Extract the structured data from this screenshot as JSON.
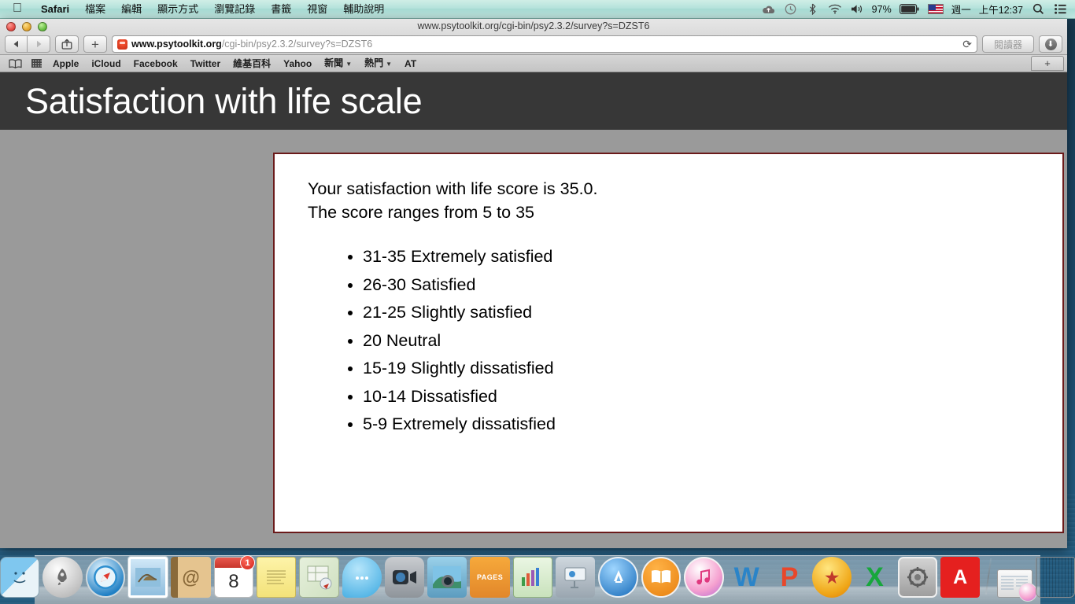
{
  "menubar": {
    "apple_logo": "apple-logo",
    "app_name": "Safari",
    "items": [
      "檔案",
      "編輯",
      "顯示方式",
      "瀏覽記錄",
      "書籤",
      "視窗",
      "輔助說明"
    ],
    "status": {
      "cloud_icon": "cloud-upload-icon",
      "timemachine_icon": "time-machine-icon",
      "bluetooth_icon": "bluetooth-icon",
      "wifi_icon": "wifi-icon",
      "volume_icon": "volume-icon",
      "battery_percent": "97%",
      "battery_icon": "battery-icon",
      "input_flag": "us-flag-icon",
      "day": "週一",
      "time": "上午12:37",
      "search_icon": "spotlight-search-icon",
      "notifications_icon": "notification-center-icon"
    }
  },
  "window": {
    "title": "www.psytoolkit.org/cgi-bin/psy2.3.2/survey?s=DZST6",
    "traffic_lights": [
      "close",
      "minimize",
      "zoom"
    ],
    "toolbar": {
      "back_label": "◀",
      "forward_label": "▶",
      "share_label": "⬆",
      "newtab_label": "+",
      "url_host": "www.psytoolkit.org",
      "url_path": "/cgi-bin/psy2.3.2/survey?s=DZST6",
      "reload_label": "⟳",
      "reader_label": "閱讀器",
      "download_label": "⬇"
    },
    "bookmarks_bar": {
      "sidebar_icon": "book-sidebar-icon",
      "topsites_icon": "top-sites-grid-icon",
      "items": [
        {
          "label": "Apple",
          "has_caret": false
        },
        {
          "label": "iCloud",
          "has_caret": false
        },
        {
          "label": "Facebook",
          "has_caret": false
        },
        {
          "label": "Twitter",
          "has_caret": false
        },
        {
          "label": "維基百科",
          "has_caret": false
        },
        {
          "label": "Yahoo",
          "has_caret": false
        },
        {
          "label": "新聞",
          "has_caret": true
        },
        {
          "label": "熱門",
          "has_caret": true
        },
        {
          "label": "AT",
          "has_caret": false
        }
      ],
      "new_tab_label": "+"
    }
  },
  "page": {
    "heading": "Satisfaction with life scale",
    "card": {
      "line1": "Your satisfaction with life score is 35.0.",
      "line2": "The score ranges from 5 to 35",
      "ranges": [
        "31-35 Extremely satisfied",
        "26-30 Satisfied",
        "21-25 Slightly satisfied",
        "20 Neutral",
        "15-19 Slightly dissatisfied",
        "10-14 Dissatisfied",
        "5-9 Extremely dissatisfied"
      ],
      "border_color": "#6b1a1a",
      "background_color": "#ffffff"
    },
    "header_background": "#373737",
    "body_background": "#9a9a9a"
  },
  "dock": {
    "items": [
      {
        "name": "finder",
        "glyph": "",
        "class": "ic-finder"
      },
      {
        "name": "launchpad",
        "glyph": "🚀",
        "class": "ic-launchpad"
      },
      {
        "name": "safari",
        "glyph": "✛",
        "class": "ic-safari"
      },
      {
        "name": "mail",
        "glyph": "",
        "class": "ic-mail"
      },
      {
        "name": "contacts",
        "glyph": "@",
        "class": "ic-contacts"
      },
      {
        "name": "calendar",
        "glyph": "8",
        "class": "ic-calendar",
        "badge": "1"
      },
      {
        "name": "notes",
        "glyph": "",
        "class": "ic-notes"
      },
      {
        "name": "maps",
        "glyph": "✦",
        "class": "ic-maps"
      },
      {
        "name": "messages",
        "glyph": "···",
        "class": "ic-messages"
      },
      {
        "name": "facetime",
        "glyph": "◉",
        "class": "ic-facetime"
      },
      {
        "name": "iphoto",
        "glyph": "◉",
        "class": "ic-iphoto"
      },
      {
        "name": "pages",
        "glyph": "PAGES",
        "class": "ic-pages"
      },
      {
        "name": "numbers",
        "glyph": "▁▄█",
        "class": "ic-numbers"
      },
      {
        "name": "keynote",
        "glyph": "▭",
        "class": "ic-keynote"
      },
      {
        "name": "app-store",
        "glyph": "A",
        "class": "ic-appstore"
      },
      {
        "name": "ibooks",
        "glyph": "📖",
        "class": "ic-ibooks"
      },
      {
        "name": "itunes",
        "glyph": "♪",
        "class": "ic-itunes"
      },
      {
        "name": "microsoft-word",
        "glyph": "W",
        "class": "ic-word"
      },
      {
        "name": "microsoft-powerpoint",
        "glyph": "P",
        "class": "ic-ppt"
      },
      {
        "name": "star-app",
        "glyph": "★",
        "class": "ic-star"
      },
      {
        "name": "microsoft-excel",
        "glyph": "X",
        "class": "ic-excel"
      },
      {
        "name": "system-preferences",
        "glyph": "⚙",
        "class": "ic-sysprefs"
      },
      {
        "name": "adobe-acrobat",
        "glyph": "A",
        "class": "ic-acrobat"
      }
    ],
    "minimized": {
      "name": "itunes-window",
      "class": "ic-minwin"
    },
    "trash": {
      "name": "trash",
      "class": "ic-trash"
    }
  }
}
